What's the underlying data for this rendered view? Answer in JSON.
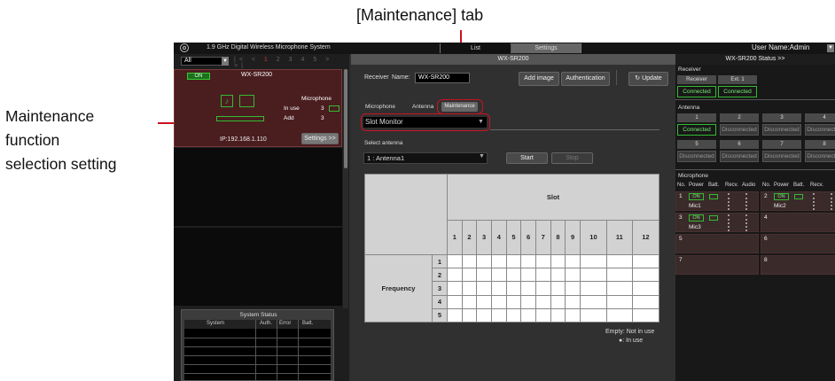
{
  "annotations": {
    "maintenance_tab": "[Maintenance] tab",
    "selection_lines": [
      "Maintenance",
      "function",
      "selection setting"
    ]
  },
  "app": {
    "title": "1.9 GHz Digital Wireless Microphone System",
    "view_tabs": [
      "List",
      "Settings"
    ],
    "user": "User Name:Admin",
    "filter": "All",
    "pages": [
      "|<",
      "<",
      "1",
      "2",
      "3",
      "4",
      "5",
      ">",
      ">|"
    ],
    "settings_title": "WX-SR200"
  },
  "receiver_card": {
    "status": "ON",
    "name": "WX-SR200",
    "microphone_label": "Microphone",
    "in_use_label": "In use",
    "in_use_count": "3",
    "add_label": "Add",
    "add_count": "3",
    "ip": "IP:192.168.1.110",
    "settings_button": "Settings >>"
  },
  "system_status": {
    "title": "System Status",
    "columns": [
      "System",
      "Auth.",
      "Error",
      "Batt."
    ]
  },
  "center": {
    "receiver_label": "Receiver",
    "name_label": "Name:",
    "name_value": "WX-SR200",
    "add_image": "Add image",
    "authentication": "Authentication",
    "update": "Update",
    "tabs": [
      "Microphone",
      "Antenna",
      "Maintenance"
    ],
    "function_select": "Slot Monitor",
    "select_antenna_label": "Select antenna",
    "antenna_select": "1 : Antenna1",
    "start": "Start",
    "stop": "Stop",
    "slot_title": "Slot",
    "slots": [
      "1",
      "2",
      "3",
      "4",
      "5",
      "6",
      "7",
      "8",
      "9",
      "10",
      "11",
      "12"
    ],
    "frequency_label": "Frequency",
    "frequencies": [
      "1",
      "2",
      "3",
      "4",
      "5"
    ],
    "legend_empty": "Empty: Not in use",
    "legend_inuse": "●: In use"
  },
  "status_panel": {
    "title": "WX-SR200 Status >>",
    "receiver_label": "Receiver",
    "receiver_cols": [
      "Receiver",
      "Ext. 1"
    ],
    "receiver_vals": [
      "Connected",
      "Connected"
    ],
    "antenna_label": "Antenna",
    "antennas": [
      {
        "num": "1",
        "state": "Connected"
      },
      {
        "num": "2",
        "state": "Disconnected"
      },
      {
        "num": "3",
        "state": "Disconnected"
      },
      {
        "num": "4",
        "state": "Disconnected"
      },
      {
        "num": "5",
        "state": "Disconnected"
      },
      {
        "num": "6",
        "state": "Disconnected"
      },
      {
        "num": "7",
        "state": "Disconnected"
      },
      {
        "num": "8",
        "state": "Disconnected"
      }
    ],
    "microphone_label": "Microphone",
    "mic_cols": [
      "No.",
      "Power",
      "Batt.",
      "Recv.",
      "Audio"
    ],
    "mics": [
      {
        "no": "1",
        "power": "ON",
        "name": "Mic1"
      },
      {
        "no": "2",
        "power": "ON",
        "name": "Mic2"
      },
      {
        "no": "3",
        "power": "ON",
        "name": "Mic3"
      },
      {
        "no": "4",
        "power": "",
        "name": ""
      },
      {
        "no": "5",
        "power": "",
        "name": ""
      },
      {
        "no": "6",
        "power": "",
        "name": ""
      },
      {
        "no": "7",
        "power": "",
        "name": ""
      },
      {
        "no": "8",
        "power": "",
        "name": ""
      }
    ]
  }
}
